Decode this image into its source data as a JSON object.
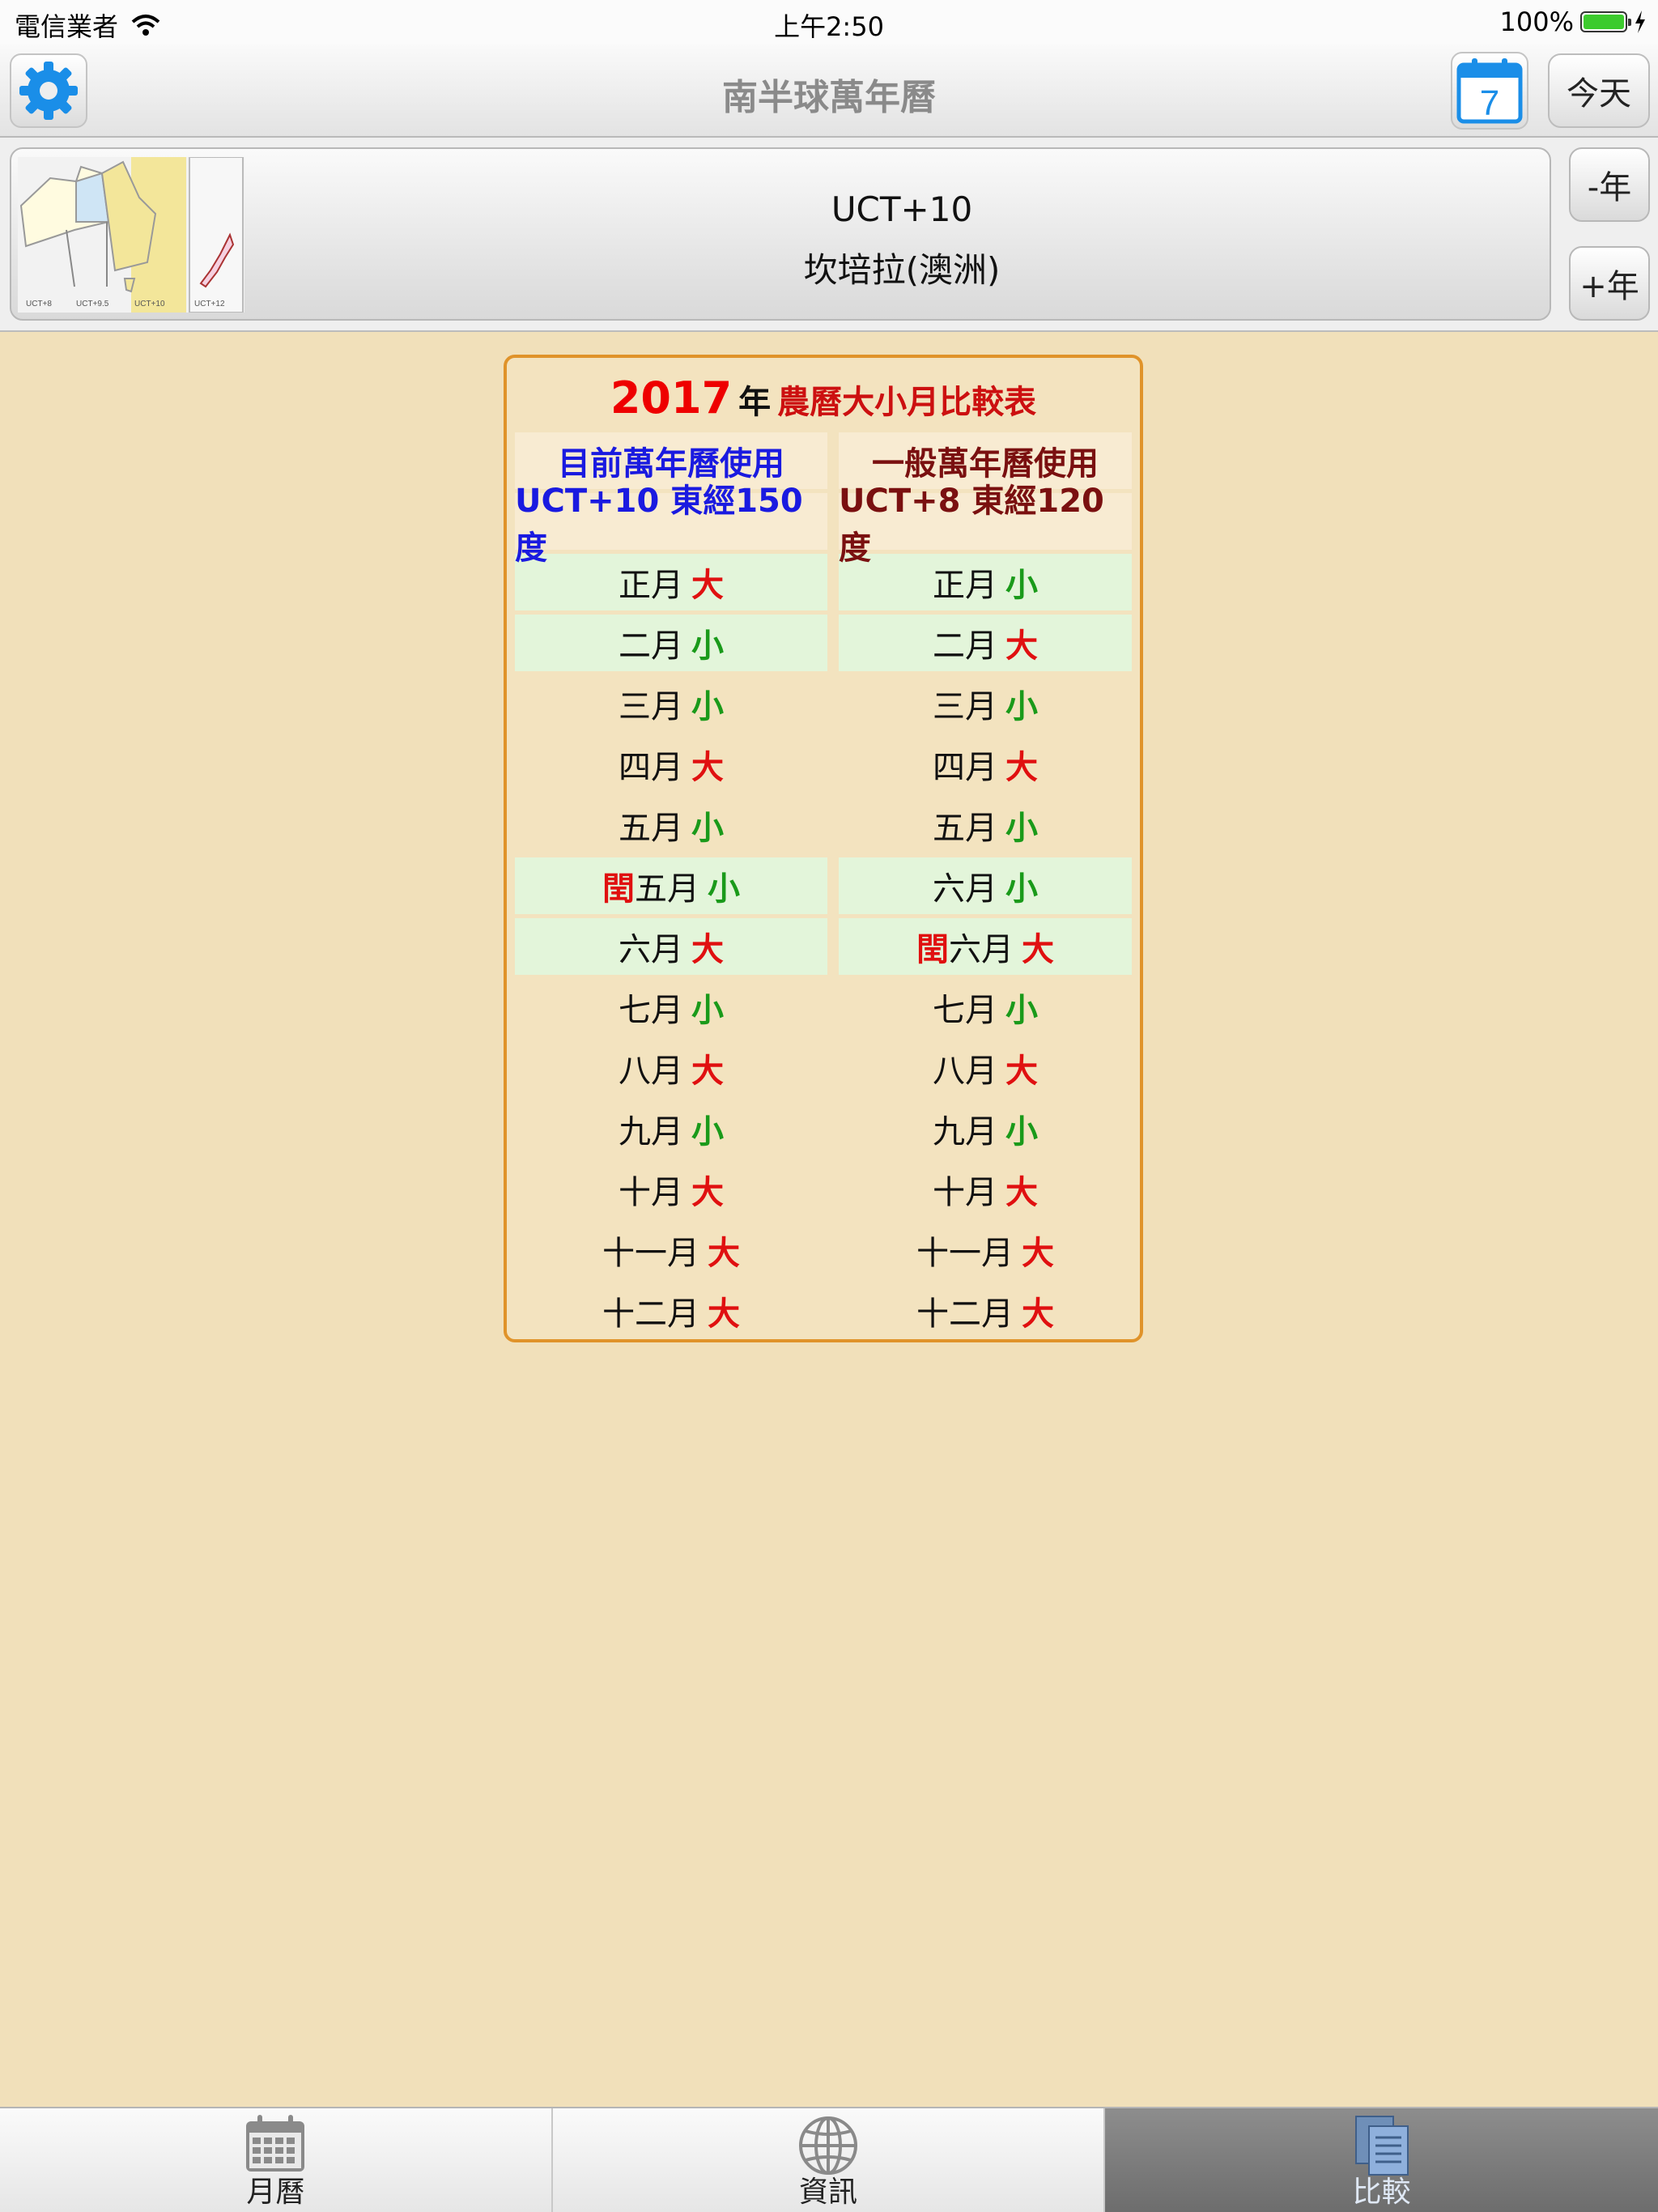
{
  "status": {
    "carrier": "電信業者",
    "time": "上午2:50",
    "battery": "100%"
  },
  "nav": {
    "title": "南半球萬年曆",
    "calendar_day": "7",
    "today_label": "今天"
  },
  "timezone": {
    "offset": "UCT+10",
    "city": "坎培拉(澳洲)",
    "map_labels": [
      "UCT+8",
      "UCT+9.5",
      "UCT+10",
      "UCT+12"
    ],
    "minus_year": "-年",
    "plus_year": "+年"
  },
  "comparison": {
    "year": "2017",
    "year_unit": "年",
    "title": "農曆大小月比較表",
    "left_header": "目前萬年曆使用",
    "right_header": "一般萬年曆使用",
    "left_sub": "UCT+10 東經150度",
    "right_sub": "UCT+8 東經120度",
    "leap_char": "閏",
    "left_months": [
      {
        "name": "正月",
        "size": "大",
        "hl": true
      },
      {
        "name": "二月",
        "size": "小",
        "hl": true
      },
      {
        "name": "三月",
        "size": "小",
        "hl": false
      },
      {
        "name": "四月",
        "size": "大",
        "hl": false
      },
      {
        "name": "五月",
        "size": "小",
        "hl": false
      },
      {
        "name": "五月",
        "size": "小",
        "hl": true,
        "leap": true
      },
      {
        "name": "六月",
        "size": "大",
        "hl": true
      },
      {
        "name": "七月",
        "size": "小",
        "hl": false
      },
      {
        "name": "八月",
        "size": "大",
        "hl": false
      },
      {
        "name": "九月",
        "size": "小",
        "hl": false
      },
      {
        "name": "十月",
        "size": "大",
        "hl": false
      },
      {
        "name": "十一月",
        "size": "大",
        "hl": false
      },
      {
        "name": "十二月",
        "size": "大",
        "hl": false
      }
    ],
    "right_months": [
      {
        "name": "正月",
        "size": "小",
        "hl": true
      },
      {
        "name": "二月",
        "size": "大",
        "hl": true
      },
      {
        "name": "三月",
        "size": "小",
        "hl": false
      },
      {
        "name": "四月",
        "size": "大",
        "hl": false
      },
      {
        "name": "五月",
        "size": "小",
        "hl": false
      },
      {
        "name": "六月",
        "size": "小",
        "hl": true
      },
      {
        "name": "六月",
        "size": "大",
        "hl": true,
        "leap": true
      },
      {
        "name": "七月",
        "size": "小",
        "hl": false
      },
      {
        "name": "八月",
        "size": "大",
        "hl": false
      },
      {
        "name": "九月",
        "size": "小",
        "hl": false
      },
      {
        "name": "十月",
        "size": "大",
        "hl": false
      },
      {
        "name": "十一月",
        "size": "大",
        "hl": false
      },
      {
        "name": "十二月",
        "size": "大",
        "hl": false
      }
    ]
  },
  "tabs": [
    {
      "label": "月曆",
      "icon": "calendar-grid-icon",
      "active": false
    },
    {
      "label": "資訊",
      "icon": "globe-icon",
      "active": false
    },
    {
      "label": "比較",
      "icon": "documents-icon",
      "active": true
    }
  ],
  "colors": {
    "big": "#e01010",
    "small": "#1a9a1a",
    "accent_blue": "#1a8ee8",
    "box_border": "#e0932a"
  }
}
